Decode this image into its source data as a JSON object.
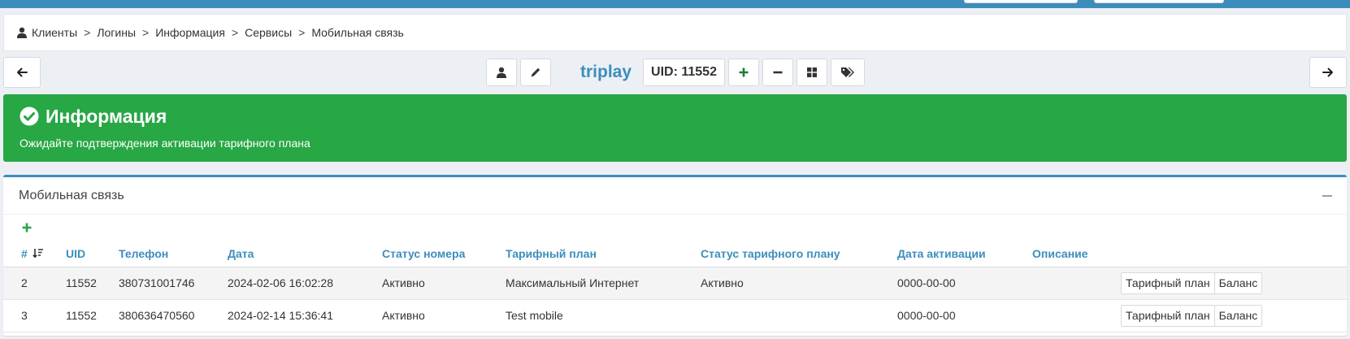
{
  "breadcrumb": {
    "items": [
      "Клиенты",
      "Логины",
      "Информация",
      "Сервисы",
      "Мобильная связь"
    ],
    "separator": ">"
  },
  "toolbar": {
    "login_name": "triplay",
    "uid_label": "UID: 11552",
    "icons": [
      "arrow-left-icon",
      "user-icon",
      "pencil-icon",
      "plus-icon",
      "minus-icon",
      "grid-icon",
      "tags-icon",
      "arrow-right-icon"
    ]
  },
  "callout": {
    "title": "Информация",
    "message": "Ожидайте подтверждения активации тарифного плана",
    "color": "#28a745"
  },
  "card": {
    "title": "Мобильная связь",
    "accent": "#3c8dbc"
  },
  "table": {
    "columns": [
      "#",
      "UID",
      "Телефон",
      "Дата",
      "Статус номера",
      "Тарифный план",
      "Статус тарифного плану",
      "Дата активации",
      "Описание",
      ""
    ],
    "rows": [
      {
        "num": "2",
        "uid": "11552",
        "phone": "380731001746",
        "date": "2024-02-06 16:02:28",
        "number_status": "Активно",
        "plan": "Максимальный Интернет",
        "plan_status": "Активно",
        "activation_date": "0000-00-00",
        "description": "",
        "btn_plan": "Тарифный план",
        "btn_balance": "Баланс"
      },
      {
        "num": "3",
        "uid": "11552",
        "phone": "380636470560",
        "date": "2024-02-14 15:36:41",
        "number_status": "Активно",
        "plan": "Test mobile",
        "plan_status": "",
        "activation_date": "0000-00-00",
        "description": "",
        "btn_plan": "Тарифный план",
        "btn_balance": "Баланс"
      }
    ]
  }
}
